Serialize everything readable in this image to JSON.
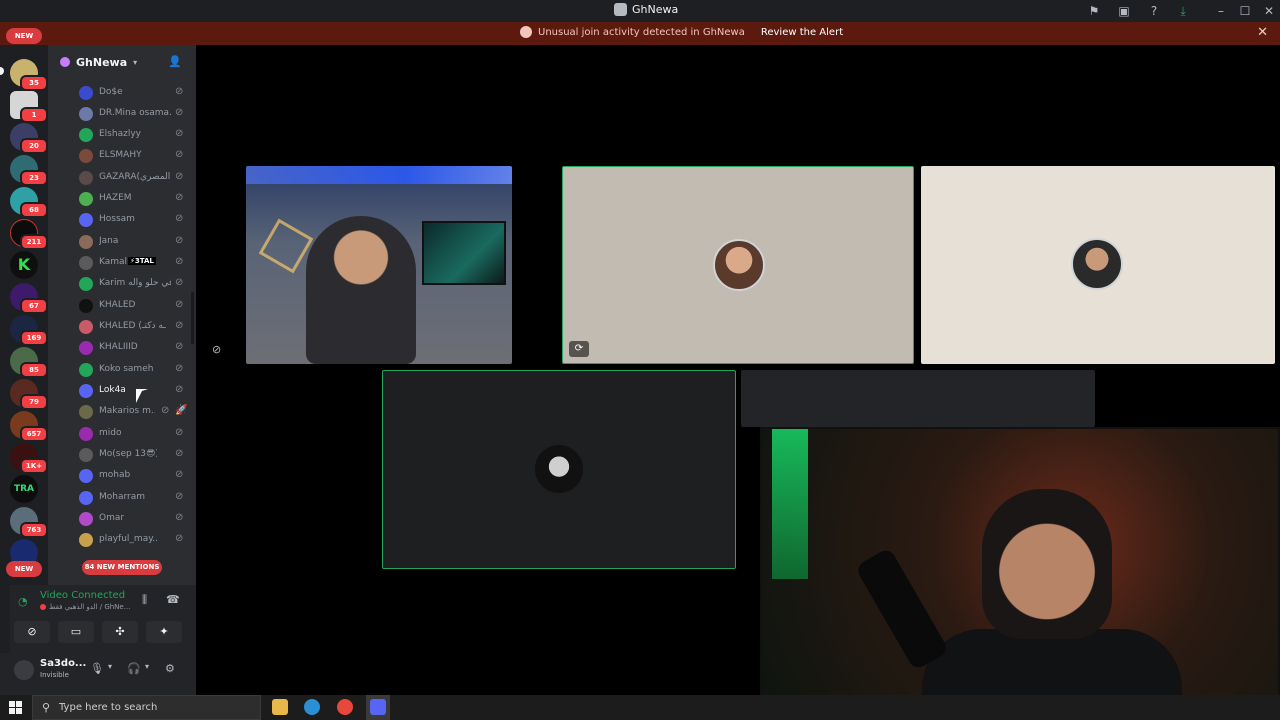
{
  "window": {
    "title": "GhNewa"
  },
  "alert": {
    "text": "Unusual join activity detected in GhNewa",
    "action": "Review the Alert"
  },
  "rail": {
    "new_label": "NEW",
    "new_bottom_label": "NEW",
    "badges": [
      "35",
      "1",
      "20",
      "23",
      "68",
      "211",
      "67",
      "169",
      "85",
      "79",
      "657",
      "1K+",
      "763"
    ]
  },
  "guild": {
    "name": "GhNewa"
  },
  "members": [
    {
      "name": "Do$e"
    },
    {
      "name": "DR.Mina osama..."
    },
    {
      "name": "Elshazlyy"
    },
    {
      "name": "ELSMAHY"
    },
    {
      "name": "GAZARA(المصري)"
    },
    {
      "name": "HAZEM"
    },
    {
      "name": "Hossam"
    },
    {
      "name": "Jana"
    },
    {
      "name": "Kamal",
      "tag": "⚡3TAL"
    },
    {
      "name": "Karim في حلو واله"
    },
    {
      "name": "KHALED"
    },
    {
      "name": "KHALED (ـه دكتـ"
    },
    {
      "name": "KHALIIID"
    },
    {
      "name": "Koko sameh"
    },
    {
      "name": "Lok4a"
    },
    {
      "name": "Makarios m..."
    },
    {
      "name": "mido"
    },
    {
      "name": "Mo(sep 13😎)"
    },
    {
      "name": "mohab"
    },
    {
      "name": "Moharram"
    },
    {
      "name": "Omar"
    },
    {
      "name": "playful_may..."
    }
  ],
  "mentions_label": "84 NEW MENTIONS",
  "voice": {
    "status": "Video Connected",
    "channel": "الدو الذهبي فقط / GhNe..."
  },
  "user": {
    "name": "Sa3do...",
    "status": "Invisible"
  },
  "taskbar": {
    "search_placeholder": "Type here to search"
  }
}
